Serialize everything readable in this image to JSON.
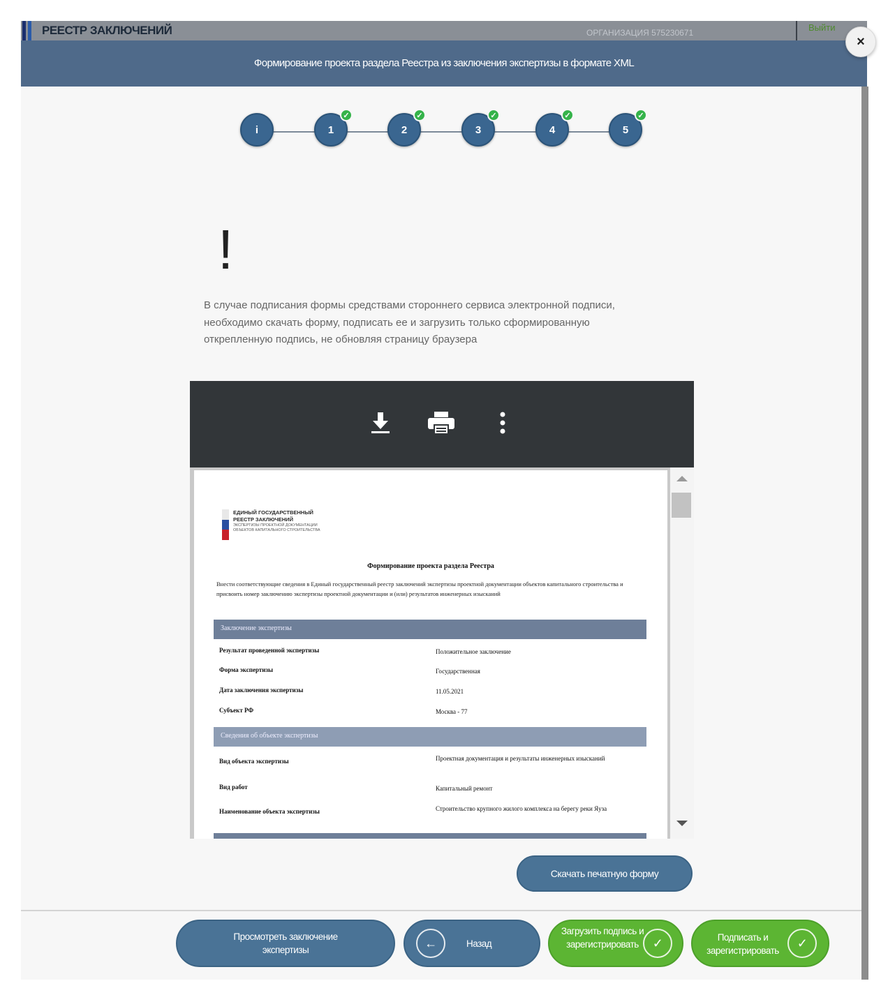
{
  "app": {
    "title": "РЕЕСТР ЗАКЛЮЧЕНИЙ",
    "organization": "ОРГАНИЗАЦИЯ 575230671",
    "exit_label": "Выйти",
    "logo_colors": [
      "#1b2f6e",
      "#2b5ba8"
    ]
  },
  "modal": {
    "title": "Формирование проекта раздела Реестра из заключения экспертизы в формате XML",
    "close_icon": "×"
  },
  "stepper": {
    "steps": [
      {
        "label": "i",
        "completed": false
      },
      {
        "label": "1",
        "completed": true
      },
      {
        "label": "2",
        "completed": true
      },
      {
        "label": "3",
        "completed": true
      },
      {
        "label": "4",
        "completed": true
      },
      {
        "label": "5",
        "completed": true
      }
    ],
    "check_glyph": "✓"
  },
  "warning": {
    "mark": "!",
    "text": "В случае подписания формы средствами стороннего сервиса электронной подписи, необходимо скачать форму, подписать ее и загрузить только сформированную открепленную подпись, не обновляя страницу браузера"
  },
  "pdf_viewer": {
    "tools": [
      "download-icon",
      "print-icon",
      "more-vert-icon"
    ],
    "document": {
      "logo_lines": [
        "Единый государственный",
        "реестр заключений"
      ],
      "logo_sub": "экспертизы проектной документации объектов капитального строительства",
      "flag_colors": [
        "#ffffff",
        "#2a4fa0",
        "#c8202a"
      ],
      "title": "Формирование проекта раздела Реестра",
      "intro": "Внести соответствующие сведения в Единый государственный реестр заключений экспертизы проектной документации объектов капитального строительства и присвоить номер заключению экспертизы проектной документации и (или) результатов инженерных изысканий",
      "sections": [
        {
          "title": "Заключение экспертизы",
          "rows": [
            {
              "key": "Результат проведенной экспертизы",
              "value": "Положительное заключение"
            },
            {
              "key": "Форма экспертизы",
              "value": "Государственная"
            },
            {
              "key": "Дата заключения экспертизы",
              "value": "11.05.2021"
            },
            {
              "key": "Субъект РФ",
              "value": "Москва - 77"
            }
          ]
        },
        {
          "title": "Сведения об объекте экспертизы",
          "rows": [
            {
              "key": "Вид объекта экспертизы",
              "value": "Проектная документация и результаты инженерных изысканий"
            },
            {
              "key": "Вид работ",
              "value": "Капитальный ремонт"
            },
            {
              "key": "Наименование объекта экспертизы",
              "value": "Строительство крупного жилого комплекса на берегу реки Яуза"
            }
          ]
        }
      ]
    }
  },
  "actions": {
    "download_print": "Скачать печатную форму",
    "view_conclusion": "Просмотреть заключение экспертизы",
    "back": "Назад",
    "back_icon": "←",
    "upload_sign": "Загрузить подпись и зарегистрировать",
    "sign_register": "Подписать и зарегистрировать",
    "check_icon": "✓"
  },
  "colors": {
    "header": "#4f6a8a",
    "primary_button": "#4a7396",
    "success_button": "#5cb533",
    "step_check": "#35b34a"
  }
}
